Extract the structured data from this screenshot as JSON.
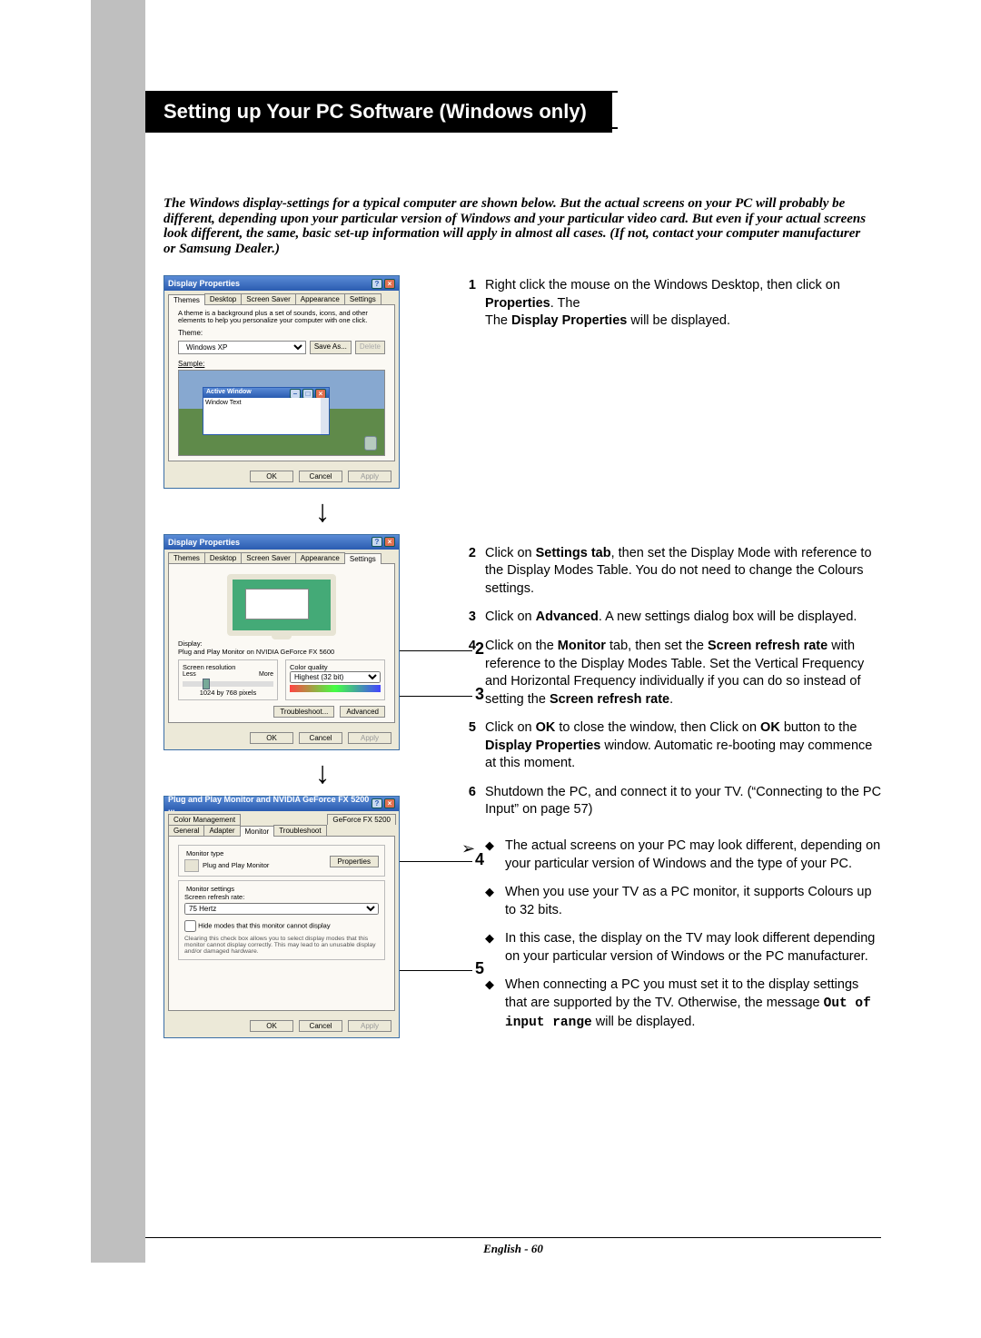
{
  "title": "Setting up Your PC Software (Windows only)",
  "intro": "The Windows display-settings for a typical computer are shown below. But the actual screens on your PC will probably be different, depending upon your particular version of Windows and your particular video card. But even if your actual screens look different, the same, basic set-up information will apply in almost all cases. (If not, contact your computer manufacturer or Samsung Dealer.)",
  "win1": {
    "title": "Display Properties",
    "tabs": [
      "Themes",
      "Desktop",
      "Screen Saver",
      "Appearance",
      "Settings"
    ],
    "desc": "A theme is a background plus a set of sounds, icons, and other elements to help you personalize your computer with one click.",
    "theme_label": "Theme:",
    "theme_value": "Windows XP",
    "save_as": "Save As...",
    "delete": "Delete",
    "sample_label": "Sample:",
    "active_window": "Active Window",
    "window_text": "Window Text",
    "ok": "OK",
    "cancel": "Cancel",
    "apply": "Apply"
  },
  "win2": {
    "title": "Display Properties",
    "tabs": [
      "Themes",
      "Desktop",
      "Screen Saver",
      "Appearance",
      "Settings"
    ],
    "display_label": "Display:",
    "display_value": "Plug and Play Monitor on NVIDIA GeForce FX 5600",
    "sr_label": "Screen resolution",
    "less": "Less",
    "more": "More",
    "res": "1024 by 768 pixels",
    "cq_label": "Color quality",
    "cq_value": "Highest (32 bit)",
    "troubleshoot": "Troubleshoot...",
    "advanced": "Advanced",
    "ok": "OK",
    "cancel": "Cancel",
    "apply": "Apply"
  },
  "win3": {
    "title": "Plug and Play Monitor and NVIDIA GeForce FX 5200 ...",
    "tabs_top": [
      "Color Management",
      "GeForce FX 5200"
    ],
    "tabs_bot": [
      "General",
      "Adapter",
      "Monitor",
      "Troubleshoot"
    ],
    "mt_label": "Monitor type",
    "mt_value": "Plug and Play Monitor",
    "properties": "Properties",
    "ms_label": "Monitor settings",
    "srr_label": "Screen refresh rate:",
    "srr_value": "75 Hertz",
    "hide": "Hide modes that this monitor cannot display",
    "hide_desc": "Clearing this check box allows you to select display modes that this monitor cannot display correctly. This may lead to an unusable display and/or damaged hardware.",
    "ok": "OK",
    "cancel": "Cancel",
    "apply": "Apply"
  },
  "callouts": {
    "c2": "2",
    "c3": "3",
    "c4": "4",
    "c5": "5"
  },
  "steps": {
    "s1": {
      "num": "1",
      "t1": "Right click the mouse on the Windows Desktop, then click on ",
      "b1": "Properties",
      "t2": ". The ",
      "b2": "Display Properties",
      "t3": " will be displayed."
    },
    "s2": {
      "num": "2",
      "t1": "Click on ",
      "b1": "Settings tab",
      "t2": ", then set the Display Mode with reference to the Display Modes Table. You do not need to change the Colours settings."
    },
    "s3": {
      "num": "3",
      "t1": "Click on ",
      "b1": "Advanced",
      "t2": ". A new settings dialog box will be displayed."
    },
    "s4": {
      "num": "4",
      "t1": "Click on the ",
      "b1": "Monitor",
      "t2": " tab, then set the ",
      "b2": "Screen refresh rate",
      "t3": " with reference to the Display Modes Table. Set the Vertical Frequency and Horizontal Frequency individually if you can do so instead of setting the ",
      "b3": "Screen refresh rate",
      "t4": "."
    },
    "s5": {
      "num": "5",
      "t1": "Click on ",
      "b1": "OK",
      "t2": " to close the window, then Click on ",
      "b2": "OK",
      "t3": " button to the ",
      "b3": "Display Properties",
      "t4": " window. Automatic re-booting may commence at this moment."
    },
    "s6": {
      "num": "6",
      "t1": "Shutdown the PC, and connect it to your TV. (“Connecting to the PC Input” on page 57)"
    }
  },
  "notes": {
    "n1": "The actual screens on your PC may look different, depending on your particular version of Windows and the type of your PC.",
    "n2": "When you use your TV as a PC monitor, it supports Colours up to 32 bits.",
    "n3": "In this case, the display on the TV may look different depending on your particular version of Windows or the PC manufacturer.",
    "n4_a": "When connecting a PC you must set it to the display settings that are supported by the TV. Otherwise, the message ",
    "n4_code": "Out of input range",
    "n4_b": " will be displayed."
  },
  "footer": "English - 60"
}
